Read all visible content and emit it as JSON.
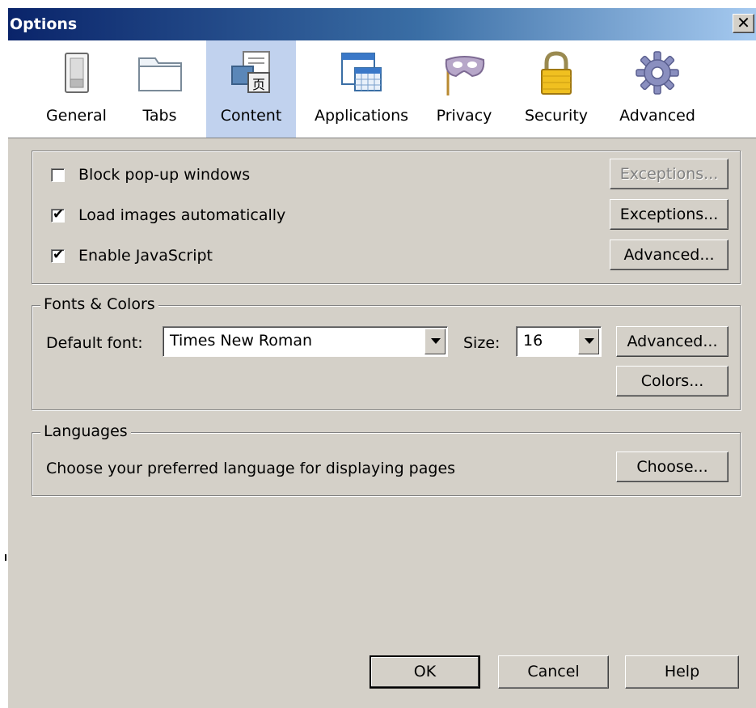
{
  "window": {
    "title": "Options",
    "close_glyph": "✕"
  },
  "toolbar": {
    "panes": [
      {
        "label": "General",
        "icon": "switch-icon"
      },
      {
        "label": "Tabs",
        "icon": "folder-tabs-icon"
      },
      {
        "label": "Content",
        "icon": "content-page-icon",
        "selected": true
      },
      {
        "label": "Applications",
        "icon": "applications-window-icon"
      },
      {
        "label": "Privacy",
        "icon": "mask-icon"
      },
      {
        "label": "Security",
        "icon": "padlock-icon"
      },
      {
        "label": "Advanced",
        "icon": "gear-icon"
      }
    ]
  },
  "content": {
    "block_popups": {
      "label": "Block pop-up windows",
      "checked": false,
      "button": "Exceptions...",
      "button_enabled": false
    },
    "load_images": {
      "label": "Load images automatically",
      "checked": true,
      "button": "Exceptions..."
    },
    "javascript": {
      "label": "Enable JavaScript",
      "checked": true,
      "button": "Advanced..."
    }
  },
  "fonts_colors": {
    "legend": "Fonts & Colors",
    "default_font_label": "Default font:",
    "default_font_value": "Times New Roman",
    "size_label": "Size:",
    "size_value": "16",
    "advanced_button": "Advanced...",
    "colors_button": "Colors..."
  },
  "languages": {
    "legend": "Languages",
    "description": "Choose your preferred language for displaying pages",
    "choose_button": "Choose..."
  },
  "footer": {
    "ok": "OK",
    "cancel": "Cancel",
    "help": "Help"
  },
  "colors": {
    "titlebar_start": "#0a246a",
    "titlebar_end": "#a6caf0",
    "selected_pane": "#c1d2ee",
    "dialog_face": "#d4d0c8"
  },
  "check_glyph": "✔"
}
